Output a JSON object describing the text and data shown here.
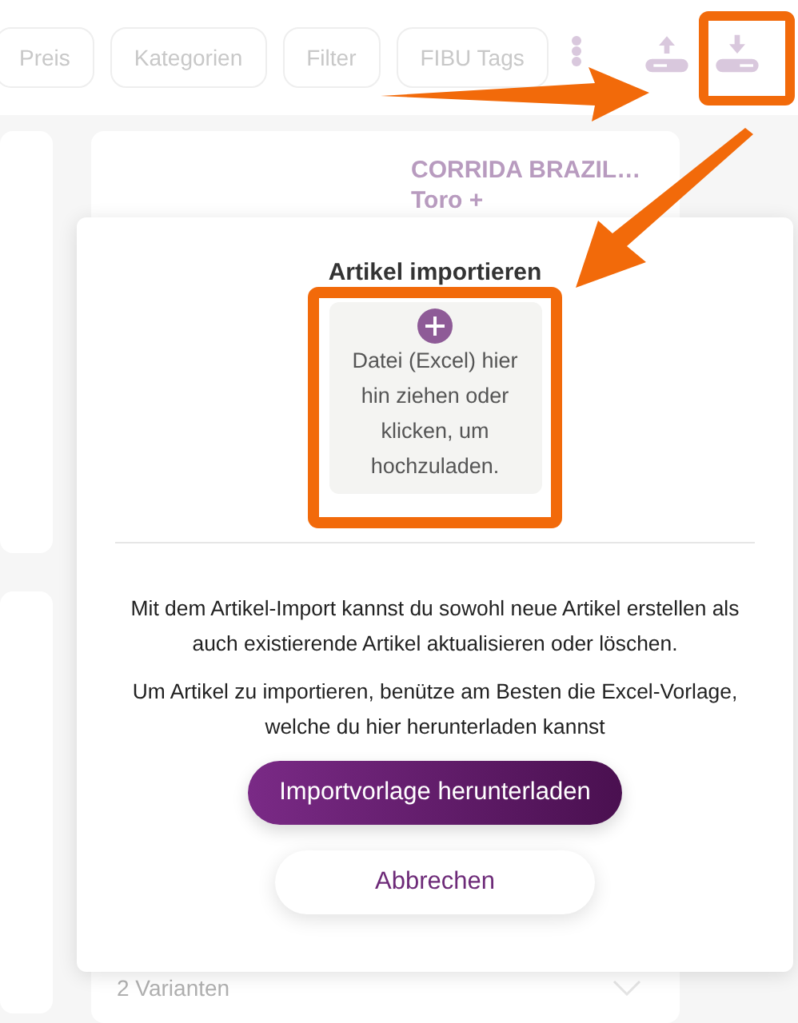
{
  "toolbar": {
    "chips": [
      "Preis",
      "Kategorien",
      "Filter",
      "FIBU Tags"
    ]
  },
  "product": {
    "title": "CORRIDA BRAZIL…",
    "subtitle": "Toro +",
    "variants": "2 Varianten"
  },
  "dialog": {
    "title": "Artikel importieren",
    "dropzone": "Datei (Excel) hier hin ziehen oder klicken, um hochzuladen.",
    "paragraphs": [
      "Mit dem Artikel-Import kannst du sowohl neue Artikel erstellen als auch existierende Artikel aktualisieren oder löschen.",
      "Um Artikel zu importieren, benütze am Besten die Excel-Vorlage, welche du hier herunterladen kannst"
    ],
    "primary_button": "Importvorlage herunterladen",
    "cancel_button": "Abbrechen"
  }
}
